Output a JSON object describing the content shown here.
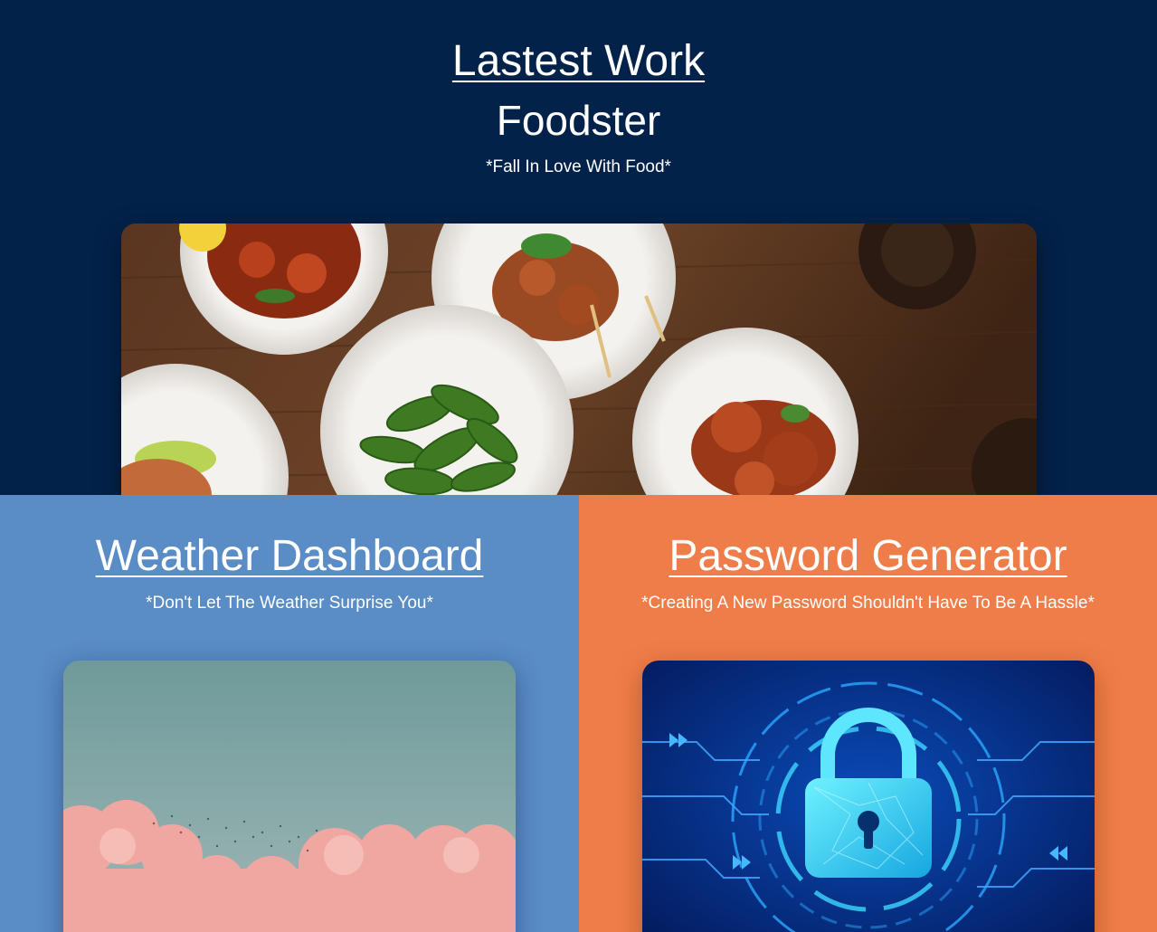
{
  "hero": {
    "heading": "Lastest Work",
    "project_title": "Foodster",
    "tagline": "*Fall In Love With Food*",
    "image_subject": "food-dishes-photo"
  },
  "projects": [
    {
      "title": "Weather Dashboard",
      "tagline": "*Don't Let The Weather Surprise You*",
      "image_subject": "sky-clouds-photo"
    },
    {
      "title": "Password Generator",
      "tagline": "*Creating A New Password Shouldn't Have To Be A Hassle*",
      "image_subject": "digital-padlock-photo"
    }
  ],
  "colors": {
    "hero_background": "#03224a",
    "weather_panel": "#5a8cc6",
    "password_panel": "#ef7d49",
    "text": "#ffffff"
  }
}
